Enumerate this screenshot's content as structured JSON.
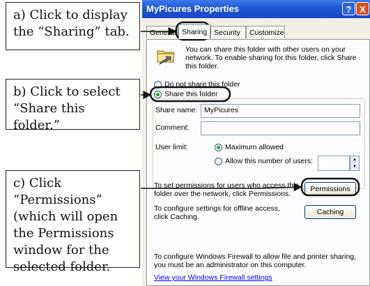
{
  "window": {
    "title": "MyPicures Properties",
    "help_label": "?",
    "close_label": "X"
  },
  "tabs": [
    {
      "label": "General"
    },
    {
      "label": "Sharing",
      "active": true
    },
    {
      "label": "Security"
    },
    {
      "label": "Customize"
    }
  ],
  "sharing": {
    "intro": "You can share this folder with other users on your network.  To enable sharing for this folder, click Share this folder.",
    "do_not_share_label": "Do not share this folder",
    "share_label": "Share this folder",
    "share_name_label": "Share name:",
    "share_name_value": "MyPicures",
    "comment_label": "Comment:",
    "comment_value": "",
    "user_limit_label": "User limit:",
    "max_allowed_label": "Maximum allowed",
    "allow_number_label": "Allow this number of users:",
    "permissions_text": "To set permissions for users who access this folder over the network, click Permissions.",
    "permissions_button": "Permissions",
    "offline_text": "To configure settings for offline access, click Caching.",
    "caching_button": "Caching",
    "firewall_text": "To configure Windows Firewall to allow file and printer sharing, you must be an administrator on this computer.",
    "firewall_link": "View your Windows Firewall settings"
  },
  "callouts": {
    "a": "a) Click to display the “Sharing” tab.",
    "b": "b) Click to select “Share this folder.”",
    "c": "c) Click “Permissions” (which will open the Permissions window for the selected folder."
  },
  "colors": {
    "titlebar": "#1f56d6",
    "selected_radio": "#21a121",
    "link": "#0000ff"
  }
}
